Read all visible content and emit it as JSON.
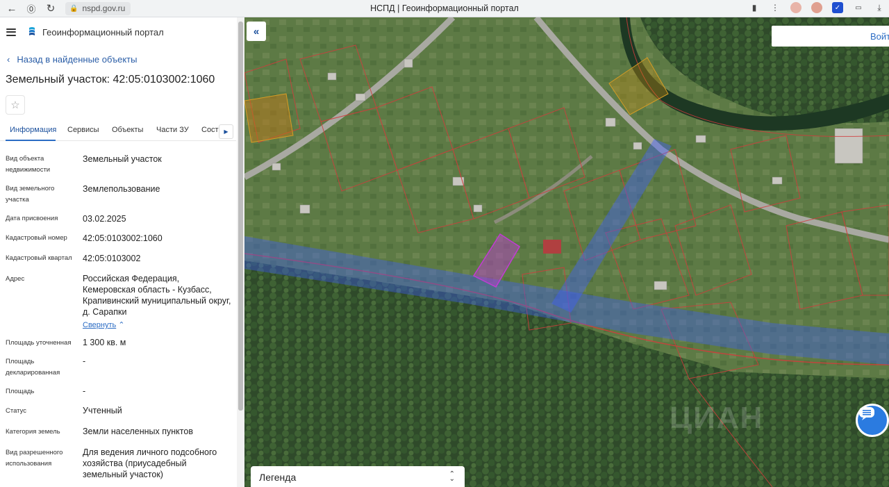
{
  "browser": {
    "url": "nspd.gov.ru",
    "tab_title": "НСПД | Геоинформационный портал"
  },
  "panel": {
    "portal_name": "Геоинформационный портал",
    "back_label": "Назад в найденные объекты",
    "parcel_title": "Земельный участок: 42:05:0103002:1060",
    "tabs": [
      "Информация",
      "Сервисы",
      "Объекты",
      "Части ЗУ",
      "Соста"
    ],
    "active_tab": "Информация",
    "properties": [
      {
        "label": "Вид объекта недвижимости",
        "value": "Земельный участок"
      },
      {
        "label": "Вид земельного участка",
        "value": "Землепользование"
      },
      {
        "label": "Дата присвоения",
        "value": "03.02.2025"
      },
      {
        "label": "Кадастровый номер",
        "value": "42:05:0103002:1060"
      },
      {
        "label": "Кадастровый квартал",
        "value": "42:05:0103002"
      },
      {
        "label": "Адрес",
        "value": "Российская Федерация, Кемеровская область - Кузбасс, Крапивинский муниципальный округ, д. Сарапки"
      },
      {
        "label": "Площадь уточненная",
        "value": "1 300 кв. м"
      },
      {
        "label": "Площадь декларированная",
        "value": "-"
      },
      {
        "label": "Площадь",
        "value": "-"
      },
      {
        "label": "Статус",
        "value": "Учтенный"
      },
      {
        "label": "Категория земель",
        "value": "Земли населенных пунктов"
      },
      {
        "label": "Вид разрешенного использования",
        "value": "Для ведения личного подсобного хозяйства (приусадебный земельный участок)"
      }
    ],
    "collapse_label": "Свернуть"
  },
  "map": {
    "login_label": "Войт",
    "legend_label": "Легенда",
    "watermark": "ЦИАН"
  },
  "colors": {
    "accent": "#2b6cc4",
    "selected_parcel": "#c23bd4",
    "zone_overlay": "#3d5cff",
    "parcel_border": "#d23c3c"
  },
  "icons": [
    "back-icon",
    "forward-icon",
    "reload-icon",
    "lock-icon",
    "bookmark-icon",
    "menu-icon",
    "star-icon",
    "chevron-left-icon",
    "chevron-right-icon",
    "double-chevron-left-icon",
    "chat-icon",
    "expand-icon"
  ]
}
